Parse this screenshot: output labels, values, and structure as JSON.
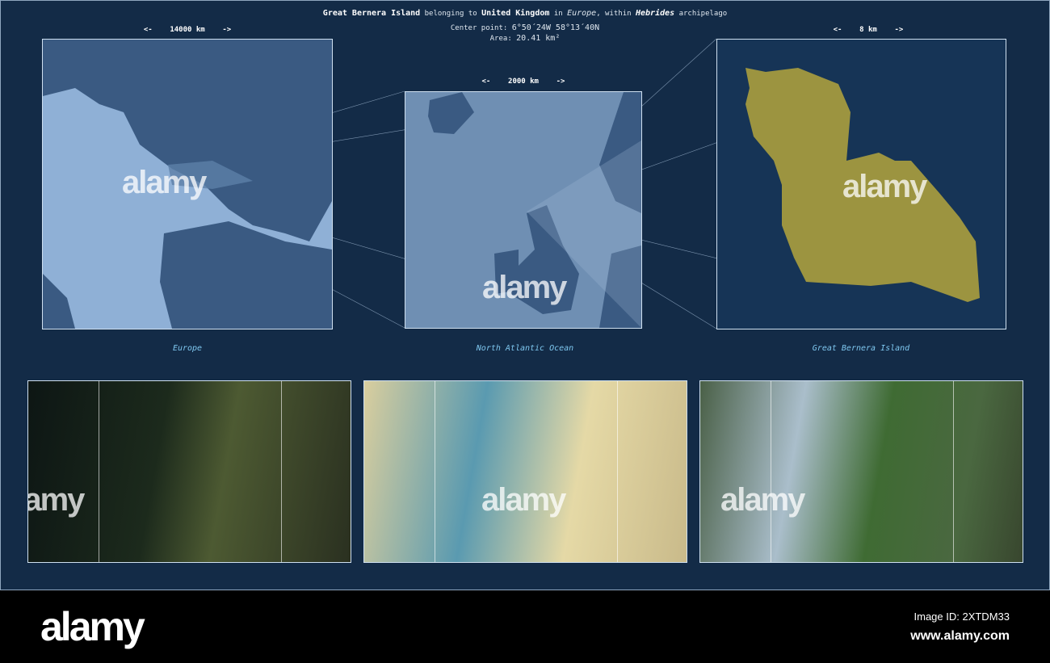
{
  "header": {
    "island": "Great Bernera Island",
    "t1": "belonging to",
    "country": "United Kingdom",
    "t2": "in",
    "continent": "Europe",
    "t3": ", within",
    "archipelago": "Hebrides",
    "t4": "archipelago",
    "center_label": "Center point:",
    "center_value": "6°50´24W  58°13´40N",
    "area_label": "Area:",
    "area_value": "20.41 km²"
  },
  "panels": [
    {
      "scale": "<-    14000 km    ->",
      "caption": "Europe"
    },
    {
      "scale": "<-    2000 km    ->",
      "caption": "North Atlantic Ocean"
    },
    {
      "scale": "<-    8 km    ->",
      "caption": "Great Bernera Island"
    }
  ],
  "watermark": "alamy",
  "footer": {
    "logo": "alamy",
    "image_id": "Image ID: 2XTDM33",
    "url": "www.alamy.com"
  },
  "colors": {
    "background": "#132b47",
    "ocean": "#8fb0d6",
    "land": "#3a5a82",
    "island": "#9c9440"
  }
}
